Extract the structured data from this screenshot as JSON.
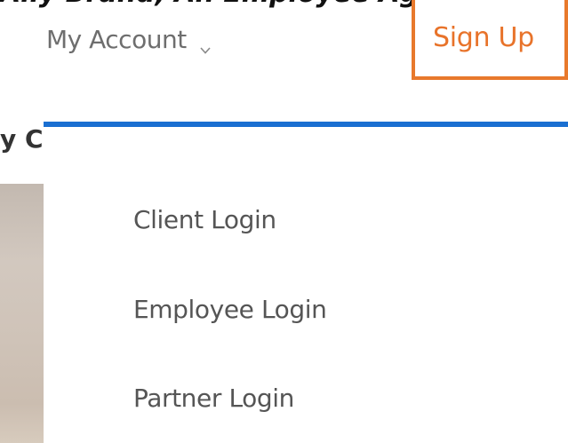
{
  "top_banner": {
    "text": "Ally Brand, An Employee Agency"
  },
  "nav": {
    "account_label": "My Account",
    "account_icon": "chevron-down-icon",
    "signup_label": "Sign Up"
  },
  "left_content": {
    "clipped_heading": "y C"
  },
  "dropdown": {
    "items": [
      {
        "label": "Client Login"
      },
      {
        "label": "Employee Login"
      },
      {
        "label": "Partner Login"
      }
    ]
  },
  "colors": {
    "accent_orange": "#e8792c",
    "dropdown_border_blue": "#1a6fd1",
    "nav_text_gray": "#6e6e6e"
  }
}
